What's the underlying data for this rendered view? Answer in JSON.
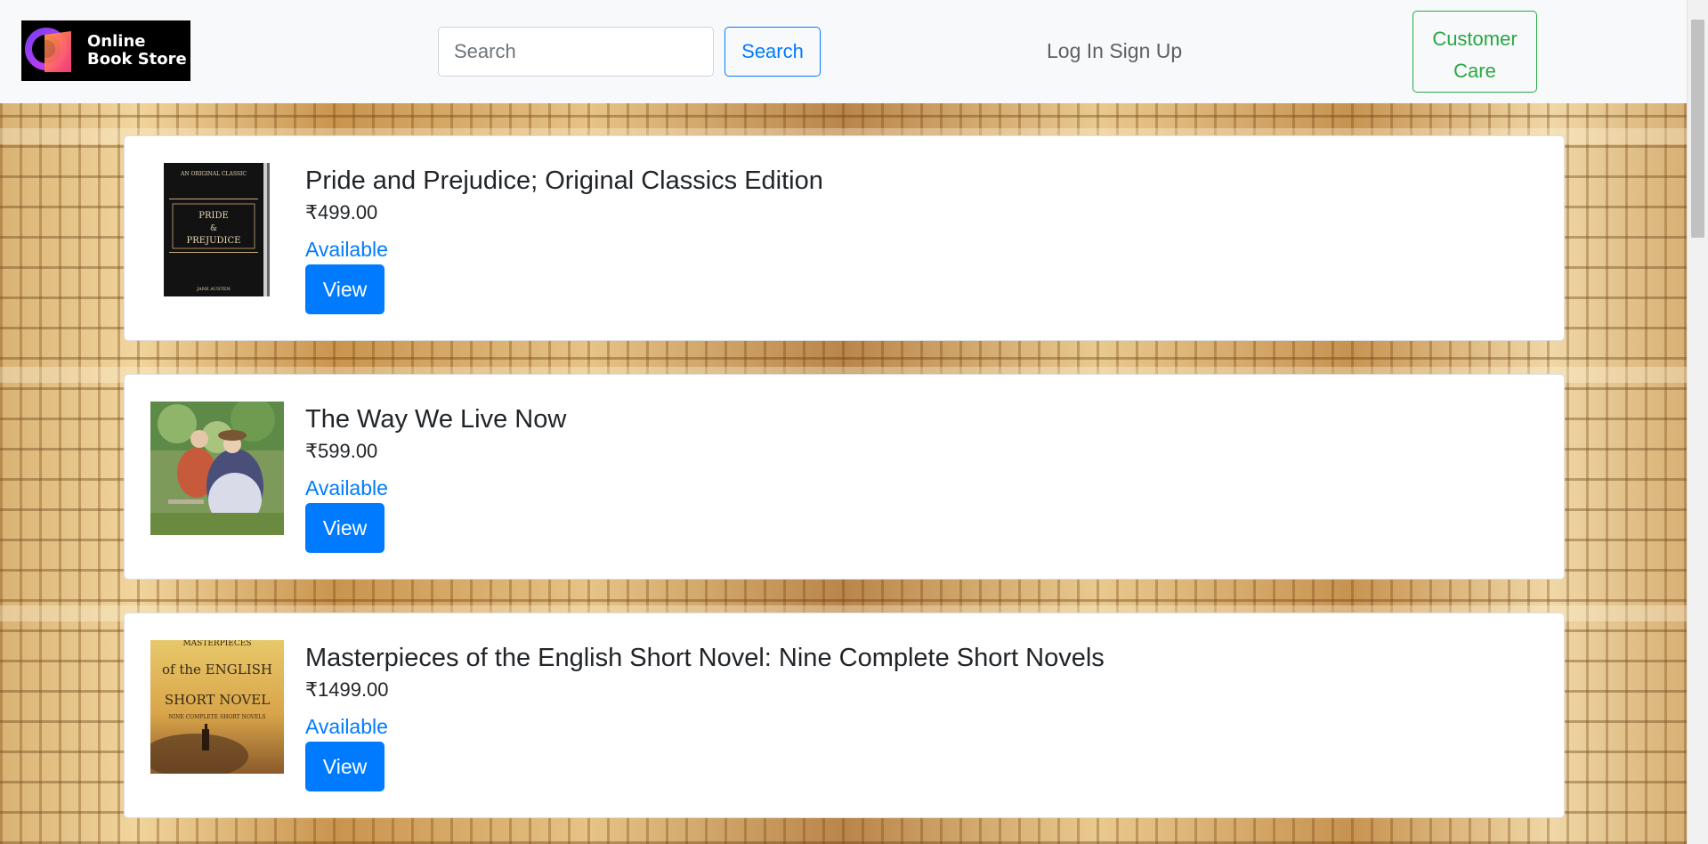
{
  "header": {
    "logo_line1": "Online",
    "logo_line2": "Book Store",
    "search_placeholder": "Search",
    "search_button": "Search",
    "login_label": "Log In",
    "signup_label": "Sign Up",
    "customer_care_line1": "Customer",
    "customer_care_line2": "Care"
  },
  "colors": {
    "primary": "#007bff",
    "success": "#28a745",
    "navbar_bg": "#f8f9fa"
  },
  "books": [
    {
      "title": "Pride and Prejudice; Original Classics Edition",
      "price": "₹499.00",
      "status": "Available",
      "view_label": "View",
      "cover": {
        "top_text": "AN ORIGINAL CLASSIC",
        "line1": "PRIDE",
        "line2": "&",
        "line3": "PREJUDICE",
        "author": "JANE AUSTEN"
      }
    },
    {
      "title": "The Way We Live Now",
      "price": "₹599.00",
      "status": "Available",
      "view_label": "View",
      "cover": {}
    },
    {
      "title": "Masterpieces of the English Short Novel: Nine Complete Short Novels",
      "price": "₹1499.00",
      "status": "Available",
      "view_label": "View",
      "cover": {
        "top_text": "MASTERPIECES",
        "line1": "of the ENGLISH",
        "line2": "SHORT NOVEL",
        "line3": "NINE COMPLETE SHORT NOVELS"
      }
    }
  ]
}
